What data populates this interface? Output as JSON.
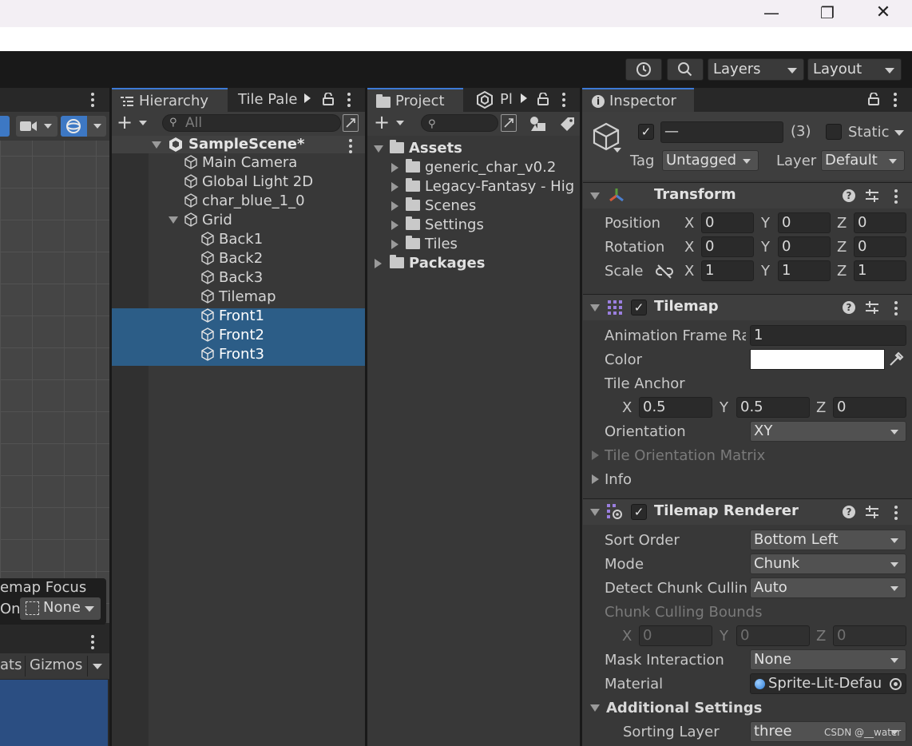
{
  "window_controls": {
    "minimize": "—",
    "maximize": "❐",
    "close": "✕"
  },
  "toolbar": {
    "layers": "Layers",
    "layout": "Layout"
  },
  "scene": {
    "tilemap_focus": "emap Focus",
    "focus_on": "On",
    "focus_value": "None",
    "game_stats": "ats",
    "gizmos": "Gizmos"
  },
  "hierarchy": {
    "tab": "Hierarchy",
    "tab2": "Tile Pale",
    "search_placeholder": "All",
    "scene_name": "SampleScene*",
    "items": [
      {
        "label": "Main Camera"
      },
      {
        "label": "Global Light 2D"
      },
      {
        "label": "char_blue_1_0"
      },
      {
        "label": "Grid"
      },
      {
        "label": "Back1"
      },
      {
        "label": "Back2"
      },
      {
        "label": "Back3"
      },
      {
        "label": "Tilemap"
      },
      {
        "label": "Front1"
      },
      {
        "label": "Front2"
      },
      {
        "label": "Front3"
      }
    ]
  },
  "project": {
    "tab": "Project",
    "tab2": "Pl",
    "assets": "Assets",
    "folders": [
      "generic_char_v0.2",
      "Legacy-Fantasy - Hig",
      "Scenes",
      "Settings",
      "Tiles"
    ],
    "packages": "Packages"
  },
  "inspector": {
    "tab": "Inspector",
    "object_name": "—",
    "count": "(3)",
    "static": "Static",
    "tag_label": "Tag",
    "tag": "Untagged",
    "layer_label": "Layer",
    "layer": "Default",
    "transform": {
      "title": "Transform",
      "position_label": "Position",
      "rotation_label": "Rotation",
      "scale_label": "Scale",
      "x": "X",
      "y": "Y",
      "z": "Z",
      "position": [
        "0",
        "0",
        "0"
      ],
      "rotation": [
        "0",
        "0",
        "0"
      ],
      "scale": [
        "1",
        "1",
        "1"
      ]
    },
    "tilemap": {
      "title": "Tilemap",
      "anim_label": "Animation Frame Rat",
      "anim_value": "1",
      "color_label": "Color",
      "color_value": "#ffffff",
      "anchor_label": "Tile Anchor",
      "anchor": [
        "0.5",
        "0.5",
        "0"
      ],
      "orientation_label": "Orientation",
      "orientation": "XY",
      "matrix_label": "Tile Orientation Matrix",
      "info_label": "Info"
    },
    "renderer": {
      "title": "Tilemap Renderer",
      "sort_label": "Sort Order",
      "sort": "Bottom Left",
      "mode_label": "Mode",
      "mode": "Chunk",
      "detect_label": "Detect Chunk Cullin",
      "detect": "Auto",
      "bounds_label": "Chunk Culling Bounds",
      "bounds": [
        "0",
        "0",
        "0"
      ],
      "mask_label": "Mask Interaction",
      "mask": "None",
      "material_label": "Material",
      "material": "Sprite-Lit-Defau",
      "additional": "Additional Settings",
      "sorting_layer_label": "Sorting Layer",
      "sorting_layer": "three"
    },
    "watermark": "CSDN @__water"
  }
}
